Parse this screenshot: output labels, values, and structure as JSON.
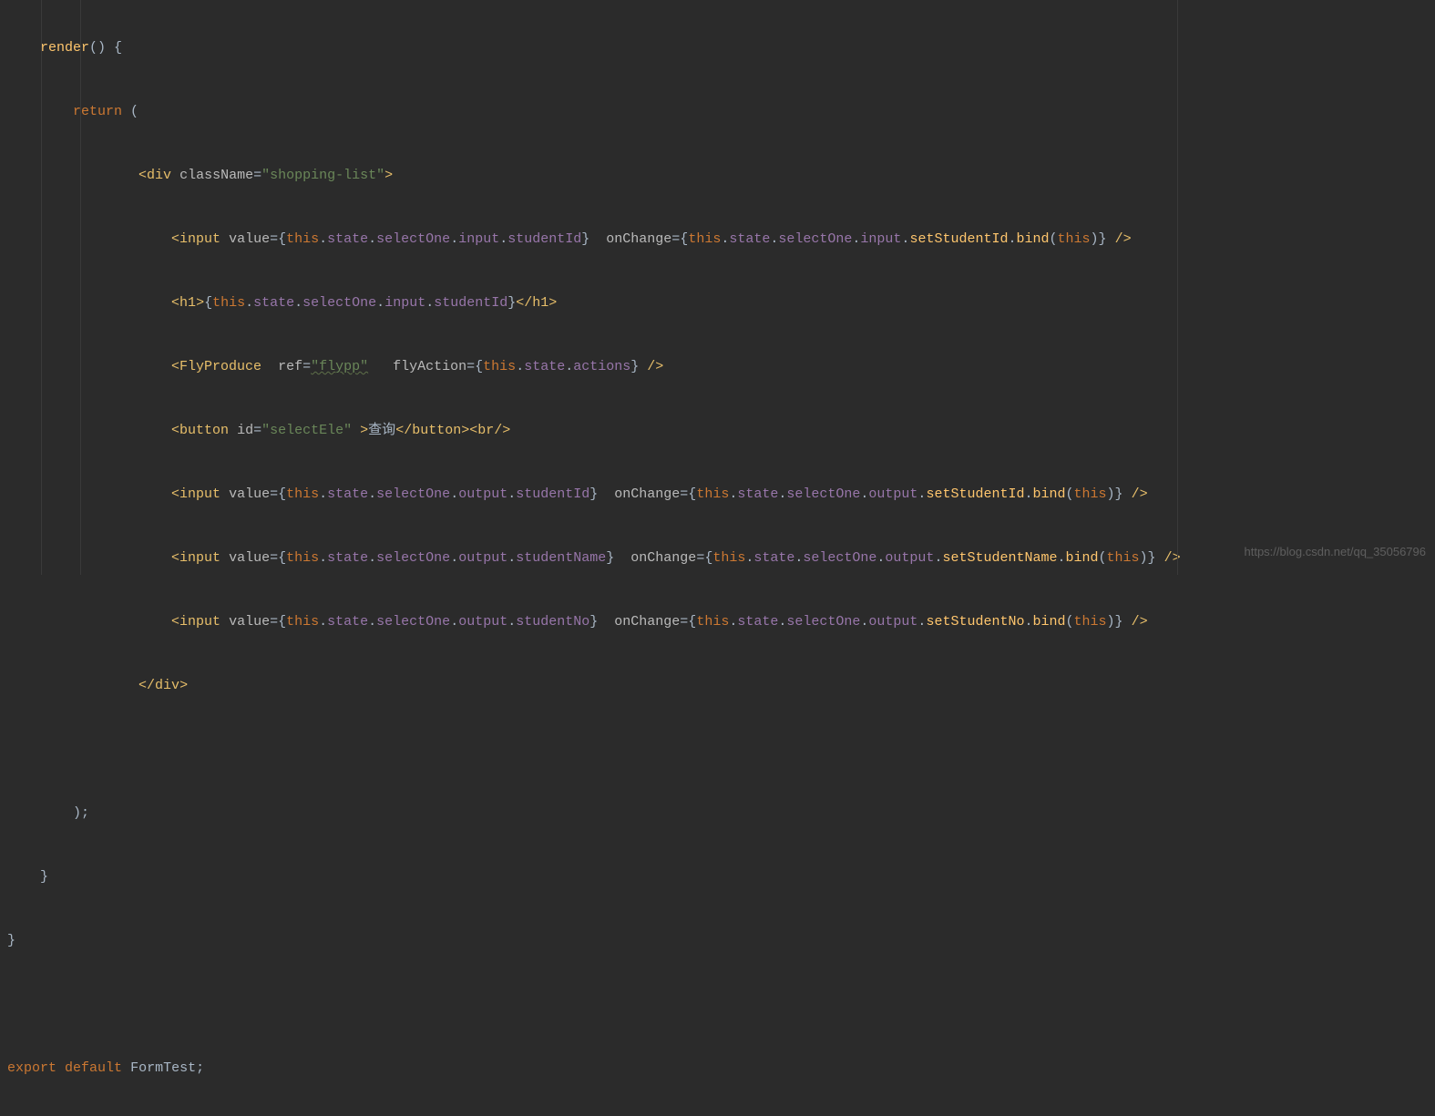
{
  "code": {
    "renderName": "render",
    "kwReturn": "return",
    "openParen": "(",
    "closeParen": ")",
    "classNameAttr": "className",
    "classNameVal": "\"shopping-list\"",
    "valueAttr": "value",
    "onChangeAttr": "onChange",
    "refAttr": "ref",
    "refVal": "\"flypp\"",
    "flyActionAttr": "flyAction",
    "idAttr": "id",
    "idVal": "\"selectEle\"",
    "buttonText": "查询",
    "thisKw": "this",
    "stateProp": "state",
    "selectOneProp": "selectOne",
    "inputProp": "input",
    "outputProp": "output",
    "studentIdProp": "studentId",
    "studentNameProp": "studentName",
    "studentNoProp": "studentNo",
    "actionsProp": "actions",
    "setStudentIdFn": "setStudentId",
    "setStudentNameFn": "setStudentName",
    "setStudentNoFn": "setStudentNo",
    "bindFn": "bind",
    "exportKw": "export",
    "defaultKw": "default",
    "formTestName": "FormTest",
    "tagDiv": "div",
    "tagInput": "input",
    "tagH1": "h1",
    "tagFlyProduce": "FlyProduce",
    "tagButton": "button",
    "tagBr": "br"
  },
  "watermark": "https://blog.csdn.net/qq_35056796"
}
